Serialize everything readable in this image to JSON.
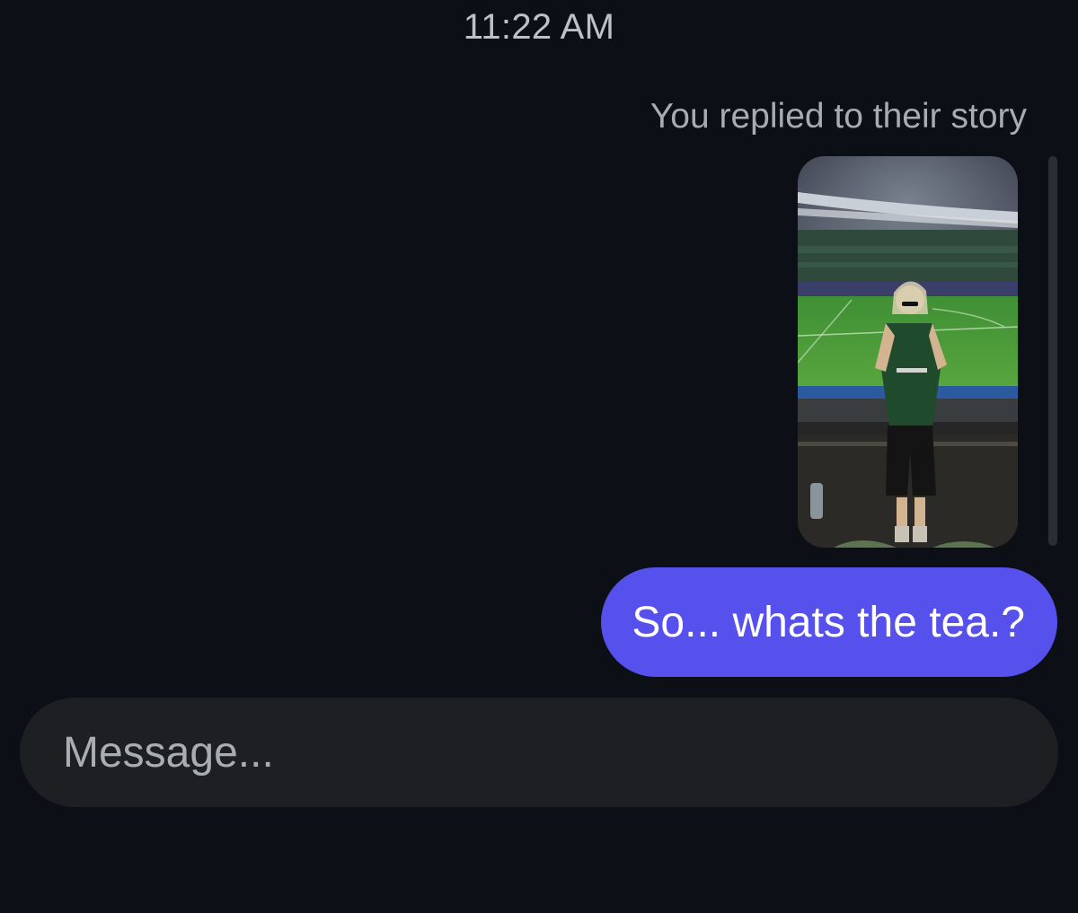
{
  "thread": {
    "timestamp": "11:22 AM",
    "reply_context": "You replied to their story",
    "story_image": "story-photo-stadium",
    "messages": [
      {
        "from": "me",
        "text": "So... whats the tea.?",
        "color": "#5651ec"
      }
    ]
  },
  "composer": {
    "placeholder": "Message...",
    "value": ""
  },
  "colors": {
    "background": "#0c0f15",
    "bubble": "#5651ec",
    "composer": "#1d1f23",
    "muted_text": "#a7abb2"
  }
}
